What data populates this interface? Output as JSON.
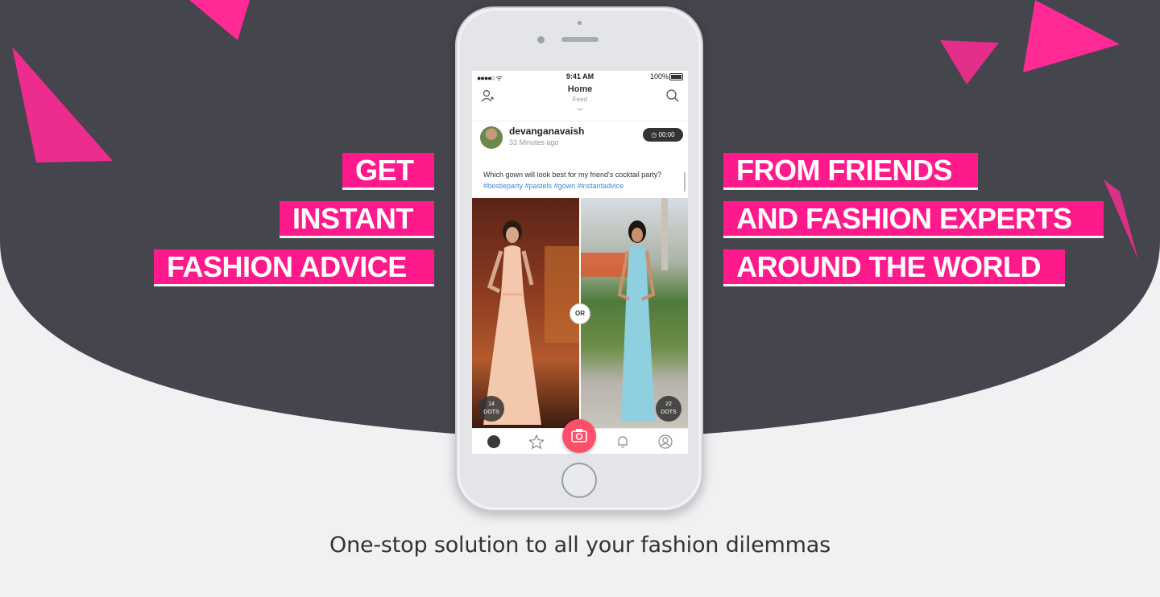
{
  "colors": {
    "accent": "#ff1a8c",
    "dark": "#45454d",
    "light": "#f1f1f3",
    "camera": "#ff4f6b"
  },
  "left_headlines": [
    "GET",
    "INSTANT",
    "FASHION ADVICE"
  ],
  "right_headlines": [
    "FROM FRIENDS",
    "AND FASHION EXPERTS",
    "AROUND THE WORLD"
  ],
  "phone": {
    "status": {
      "time": "9:41 AM",
      "battery": "100%",
      "battery_fraction": 1.0
    },
    "nav": {
      "title": "Home",
      "subtitle": "Feed",
      "left_icon": "add-user-icon",
      "right_icon": "search-icon"
    },
    "post": {
      "username": "devanganavaish",
      "time_ago": "33 Minutes ago",
      "timer": "00:00",
      "caption": "Which gown will look best for my friend's cocktail party?",
      "hashtags": "#bestieparty #pastels #gown #instantadvice",
      "or_label": "OR",
      "left_option": {
        "count": "14",
        "unit": "DOTS"
      },
      "right_option": {
        "count": "22",
        "unit": "DOTS"
      }
    },
    "tabs": [
      "home-icon",
      "star-icon",
      "camera-icon",
      "bell-icon",
      "profile-icon"
    ]
  },
  "tagline": "One-stop solution to all your fashion dilemmas"
}
